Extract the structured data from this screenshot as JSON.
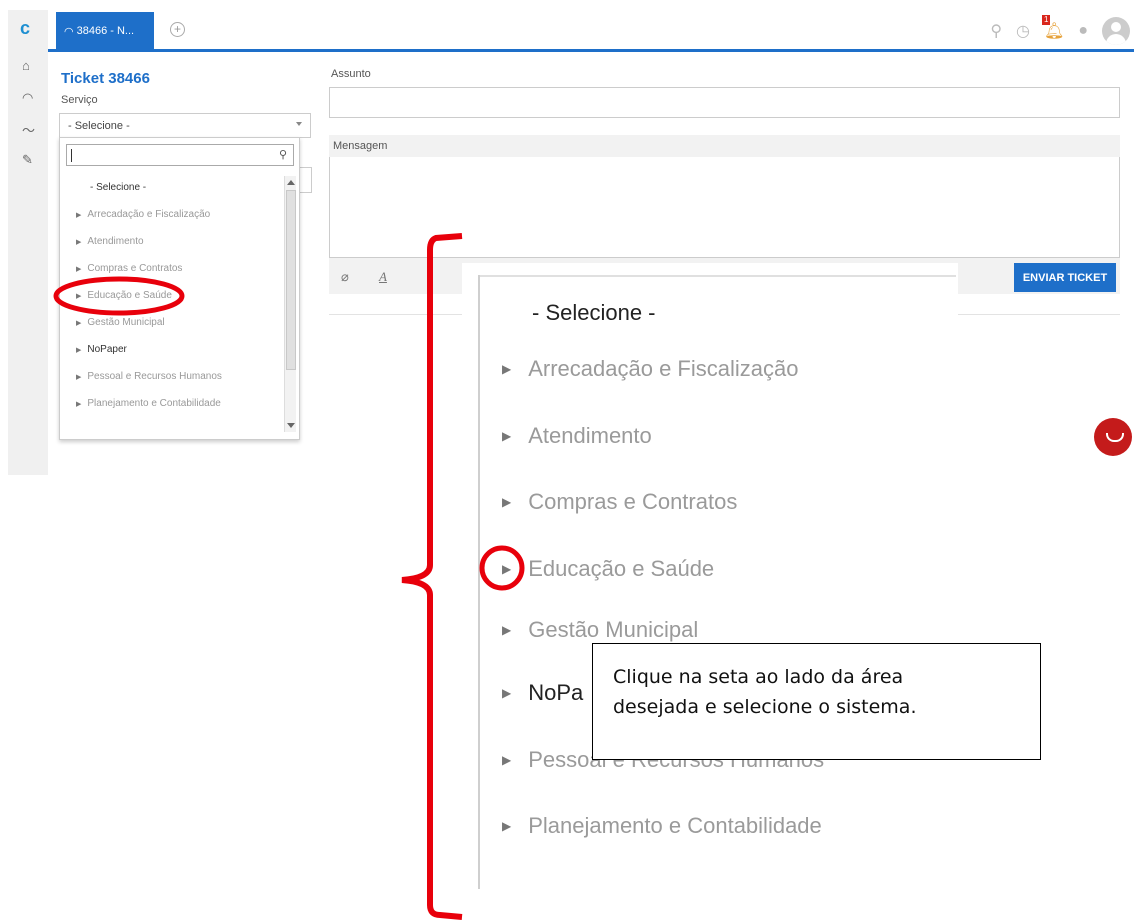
{
  "tabs": {
    "active_label": "38466 - N...",
    "add_symbol": "+"
  },
  "top_icons": {
    "notification_count": "1"
  },
  "rail": {
    "logo": "c"
  },
  "ticket": {
    "title": "Ticket 38466",
    "service_label": "Serviço",
    "service_value": "- Selecione -"
  },
  "dropdown": {
    "items": [
      {
        "label": "- Selecione -",
        "has_arrow": false
      },
      {
        "label": "Arrecadação e Fiscalização",
        "has_arrow": true
      },
      {
        "label": "Atendimento",
        "has_arrow": true
      },
      {
        "label": "Compras e Contratos",
        "has_arrow": true
      },
      {
        "label": "Educação e Saúde",
        "has_arrow": true
      },
      {
        "label": "Gestão Municipal",
        "has_arrow": true
      },
      {
        "label": "NoPaper",
        "has_arrow": true
      },
      {
        "label": "Pessoal e Recursos Humanos",
        "has_arrow": true
      },
      {
        "label": "Planejamento e Contabilidade",
        "has_arrow": true
      }
    ]
  },
  "form": {
    "subject_label": "Assunto",
    "message_label": "Mensagem",
    "send_button": "ENVIAR TICKET"
  },
  "zoom_items": [
    "- Selecione -",
    "Arrecadação e Fiscalização",
    "Atendimento",
    "Compras e Contratos",
    "Educação e Saúde",
    "Gestão Municipal",
    "NoPa",
    "Pessoal e Recursos Humanos",
    "Planejamento e Contabilidade"
  ],
  "callout": {
    "line1": "Clique na seta ao lado da área",
    "line2": "desejada e selecione o sistema."
  },
  "colors": {
    "brand_blue": "#1e6fc9",
    "annotation_red": "#e8000b"
  }
}
